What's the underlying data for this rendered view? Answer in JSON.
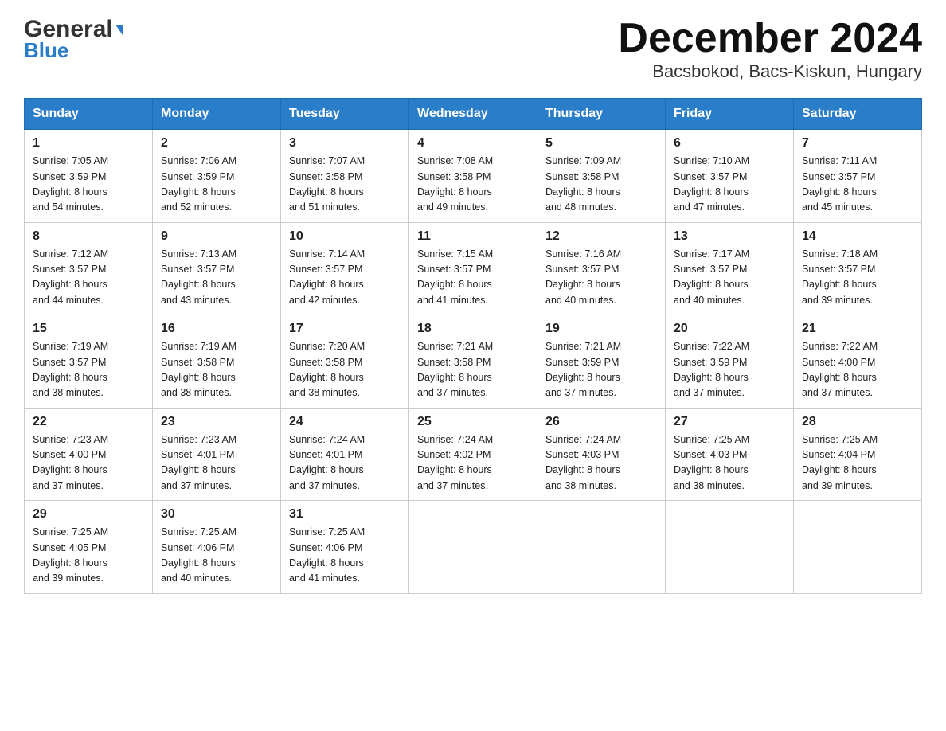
{
  "logo": {
    "general": "General",
    "blue": "Blue",
    "tagline": "Blue"
  },
  "title": "December 2024",
  "subtitle": "Bacsbokod, Bacs-Kiskun, Hungary",
  "days_of_week": [
    "Sunday",
    "Monday",
    "Tuesday",
    "Wednesday",
    "Thursday",
    "Friday",
    "Saturday"
  ],
  "weeks": [
    [
      {
        "day": "1",
        "sunrise": "7:05 AM",
        "sunset": "3:59 PM",
        "daylight": "8 hours and 54 minutes."
      },
      {
        "day": "2",
        "sunrise": "7:06 AM",
        "sunset": "3:59 PM",
        "daylight": "8 hours and 52 minutes."
      },
      {
        "day": "3",
        "sunrise": "7:07 AM",
        "sunset": "3:58 PM",
        "daylight": "8 hours and 51 minutes."
      },
      {
        "day": "4",
        "sunrise": "7:08 AM",
        "sunset": "3:58 PM",
        "daylight": "8 hours and 49 minutes."
      },
      {
        "day": "5",
        "sunrise": "7:09 AM",
        "sunset": "3:58 PM",
        "daylight": "8 hours and 48 minutes."
      },
      {
        "day": "6",
        "sunrise": "7:10 AM",
        "sunset": "3:57 PM",
        "daylight": "8 hours and 47 minutes."
      },
      {
        "day": "7",
        "sunrise": "7:11 AM",
        "sunset": "3:57 PM",
        "daylight": "8 hours and 45 minutes."
      }
    ],
    [
      {
        "day": "8",
        "sunrise": "7:12 AM",
        "sunset": "3:57 PM",
        "daylight": "8 hours and 44 minutes."
      },
      {
        "day": "9",
        "sunrise": "7:13 AM",
        "sunset": "3:57 PM",
        "daylight": "8 hours and 43 minutes."
      },
      {
        "day": "10",
        "sunrise": "7:14 AM",
        "sunset": "3:57 PM",
        "daylight": "8 hours and 42 minutes."
      },
      {
        "day": "11",
        "sunrise": "7:15 AM",
        "sunset": "3:57 PM",
        "daylight": "8 hours and 41 minutes."
      },
      {
        "day": "12",
        "sunrise": "7:16 AM",
        "sunset": "3:57 PM",
        "daylight": "8 hours and 40 minutes."
      },
      {
        "day": "13",
        "sunrise": "7:17 AM",
        "sunset": "3:57 PM",
        "daylight": "8 hours and 40 minutes."
      },
      {
        "day": "14",
        "sunrise": "7:18 AM",
        "sunset": "3:57 PM",
        "daylight": "8 hours and 39 minutes."
      }
    ],
    [
      {
        "day": "15",
        "sunrise": "7:19 AM",
        "sunset": "3:57 PM",
        "daylight": "8 hours and 38 minutes."
      },
      {
        "day": "16",
        "sunrise": "7:19 AM",
        "sunset": "3:58 PM",
        "daylight": "8 hours and 38 minutes."
      },
      {
        "day": "17",
        "sunrise": "7:20 AM",
        "sunset": "3:58 PM",
        "daylight": "8 hours and 38 minutes."
      },
      {
        "day": "18",
        "sunrise": "7:21 AM",
        "sunset": "3:58 PM",
        "daylight": "8 hours and 37 minutes."
      },
      {
        "day": "19",
        "sunrise": "7:21 AM",
        "sunset": "3:59 PM",
        "daylight": "8 hours and 37 minutes."
      },
      {
        "day": "20",
        "sunrise": "7:22 AM",
        "sunset": "3:59 PM",
        "daylight": "8 hours and 37 minutes."
      },
      {
        "day": "21",
        "sunrise": "7:22 AM",
        "sunset": "4:00 PM",
        "daylight": "8 hours and 37 minutes."
      }
    ],
    [
      {
        "day": "22",
        "sunrise": "7:23 AM",
        "sunset": "4:00 PM",
        "daylight": "8 hours and 37 minutes."
      },
      {
        "day": "23",
        "sunrise": "7:23 AM",
        "sunset": "4:01 PM",
        "daylight": "8 hours and 37 minutes."
      },
      {
        "day": "24",
        "sunrise": "7:24 AM",
        "sunset": "4:01 PM",
        "daylight": "8 hours and 37 minutes."
      },
      {
        "day": "25",
        "sunrise": "7:24 AM",
        "sunset": "4:02 PM",
        "daylight": "8 hours and 37 minutes."
      },
      {
        "day": "26",
        "sunrise": "7:24 AM",
        "sunset": "4:03 PM",
        "daylight": "8 hours and 38 minutes."
      },
      {
        "day": "27",
        "sunrise": "7:25 AM",
        "sunset": "4:03 PM",
        "daylight": "8 hours and 38 minutes."
      },
      {
        "day": "28",
        "sunrise": "7:25 AM",
        "sunset": "4:04 PM",
        "daylight": "8 hours and 39 minutes."
      }
    ],
    [
      {
        "day": "29",
        "sunrise": "7:25 AM",
        "sunset": "4:05 PM",
        "daylight": "8 hours and 39 minutes."
      },
      {
        "day": "30",
        "sunrise": "7:25 AM",
        "sunset": "4:06 PM",
        "daylight": "8 hours and 40 minutes."
      },
      {
        "day": "31",
        "sunrise": "7:25 AM",
        "sunset": "4:06 PM",
        "daylight": "8 hours and 41 minutes."
      },
      null,
      null,
      null,
      null
    ]
  ],
  "labels": {
    "sunrise": "Sunrise:",
    "sunset": "Sunset:",
    "daylight": "Daylight:"
  }
}
